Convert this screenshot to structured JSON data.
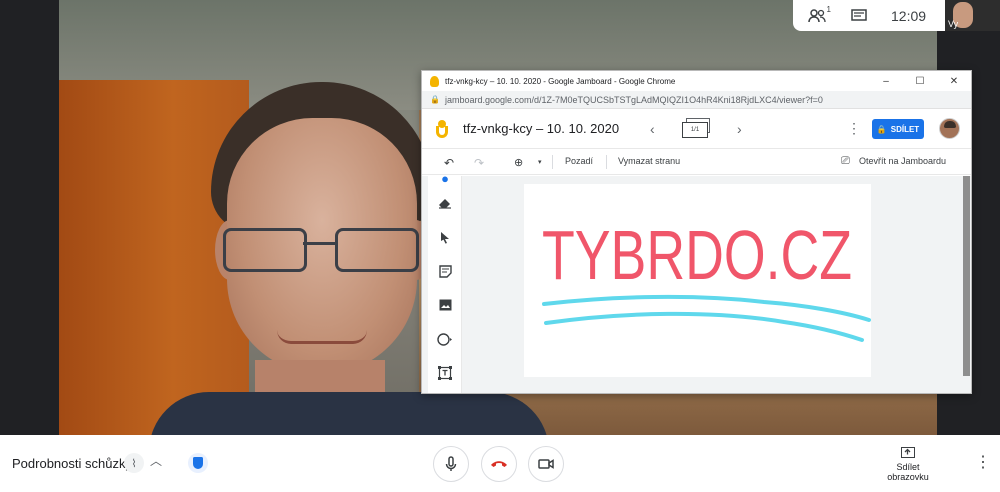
{
  "meet_top": {
    "participants_count": "1",
    "clock": "12:09",
    "self_name": "Vy",
    "icons": [
      "people-icon",
      "chat-icon"
    ]
  },
  "chrome_window": {
    "title": "tfz-vnkg-kcy – 10. 10. 2020 - Google Jamboard - Google Chrome",
    "url": "jamboard.google.com/d/1Z-7M0eTQUCSbTSTgLAdMQIQZI1O4hR4Kni18RjdLXC4/viewer?f=0",
    "controls": [
      "–",
      "☐",
      "✕"
    ]
  },
  "jamboard": {
    "title": "tfz-vnkg-kcy – 10. 10. 2020",
    "frame_counter": "1/1",
    "share_label": "SDÍLET",
    "toolbar": {
      "background_label": "Pozadí",
      "clear_label": "Vymazat stranu",
      "open_label": "Otevřít na Jamboardu"
    },
    "tools": [
      "eraser-icon",
      "select-icon",
      "sticky-note-icon",
      "image-icon",
      "circle-icon",
      "text-box-icon"
    ],
    "canvas_text": "TYBRDO.CZ",
    "colors": {
      "ink_text": "#f0566a",
      "ink_underline": "#5fd8ec",
      "share_bg": "#1a73e8"
    }
  },
  "bottom_bar": {
    "details_label": "Podrobnosti schůzky",
    "present_label": "Sdílet obrazovku",
    "colors": {
      "end_call": "#d93025"
    }
  }
}
